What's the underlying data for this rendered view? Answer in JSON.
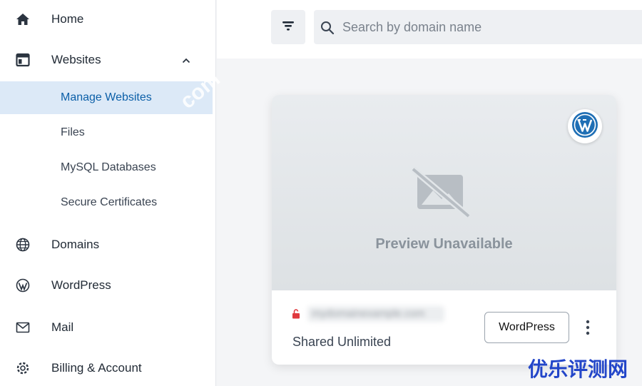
{
  "sidebar": {
    "nav": [
      {
        "label": "Home",
        "icon": "home-icon"
      },
      {
        "label": "Websites",
        "icon": "websites-icon",
        "expanded": true
      },
      {
        "label": "Domains",
        "icon": "globe-icon"
      },
      {
        "label": "WordPress",
        "icon": "wordpress-icon"
      },
      {
        "label": "Mail",
        "icon": "mail-icon"
      },
      {
        "label": "Billing & Account",
        "icon": "gear-icon"
      }
    ],
    "websites_sub": [
      {
        "label": "Manage Websites",
        "active": true
      },
      {
        "label": "Files"
      },
      {
        "label": "MySQL Databases"
      },
      {
        "label": "Secure Certificates"
      }
    ]
  },
  "topbar": {
    "search_placeholder": "Search by domain name"
  },
  "card": {
    "preview_text": "Preview Unavailable",
    "domain": "mydomainexample.com",
    "plan": "Shared Unlimited",
    "wordpress_button": "WordPress"
  },
  "watermarks": {
    "diagonal": "com",
    "corner": "优乐评测网"
  },
  "colors": {
    "accent": "#0b5fa8",
    "active_bg": "#dce9f7",
    "wordpress_blue": "#1f6fb5",
    "lock_red": "#e0393e"
  }
}
